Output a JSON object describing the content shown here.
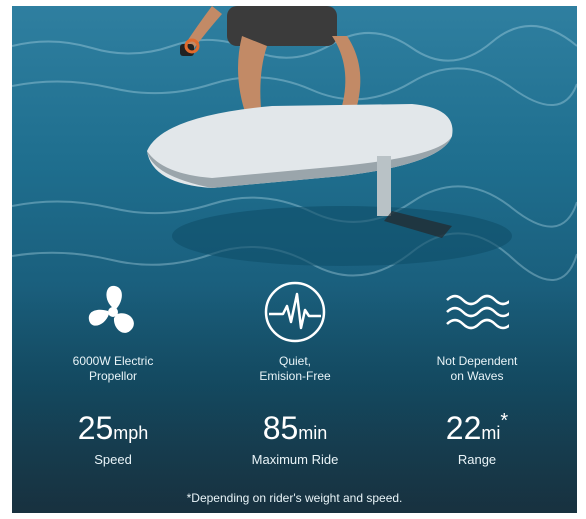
{
  "features": [
    {
      "icon": "propeller-icon",
      "label": "6000W Electric\nPropellor"
    },
    {
      "icon": "waveform-circle-icon",
      "label": "Quiet,\nEmision-Free"
    },
    {
      "icon": "waves-icon",
      "label": "Not Dependent\non Waves"
    }
  ],
  "stats": [
    {
      "value": "25",
      "unit": "mph",
      "star": "",
      "caption": "Speed"
    },
    {
      "value": "85",
      "unit": "min",
      "star": "",
      "caption": "Maximum Ride"
    },
    {
      "value": "22",
      "unit": "mi",
      "star": "*",
      "caption": "Range"
    }
  ],
  "footnote": "*Depending on rider's weight and speed.",
  "colors": {
    "water": "#1f6f8f",
    "text": "#ffffff"
  }
}
